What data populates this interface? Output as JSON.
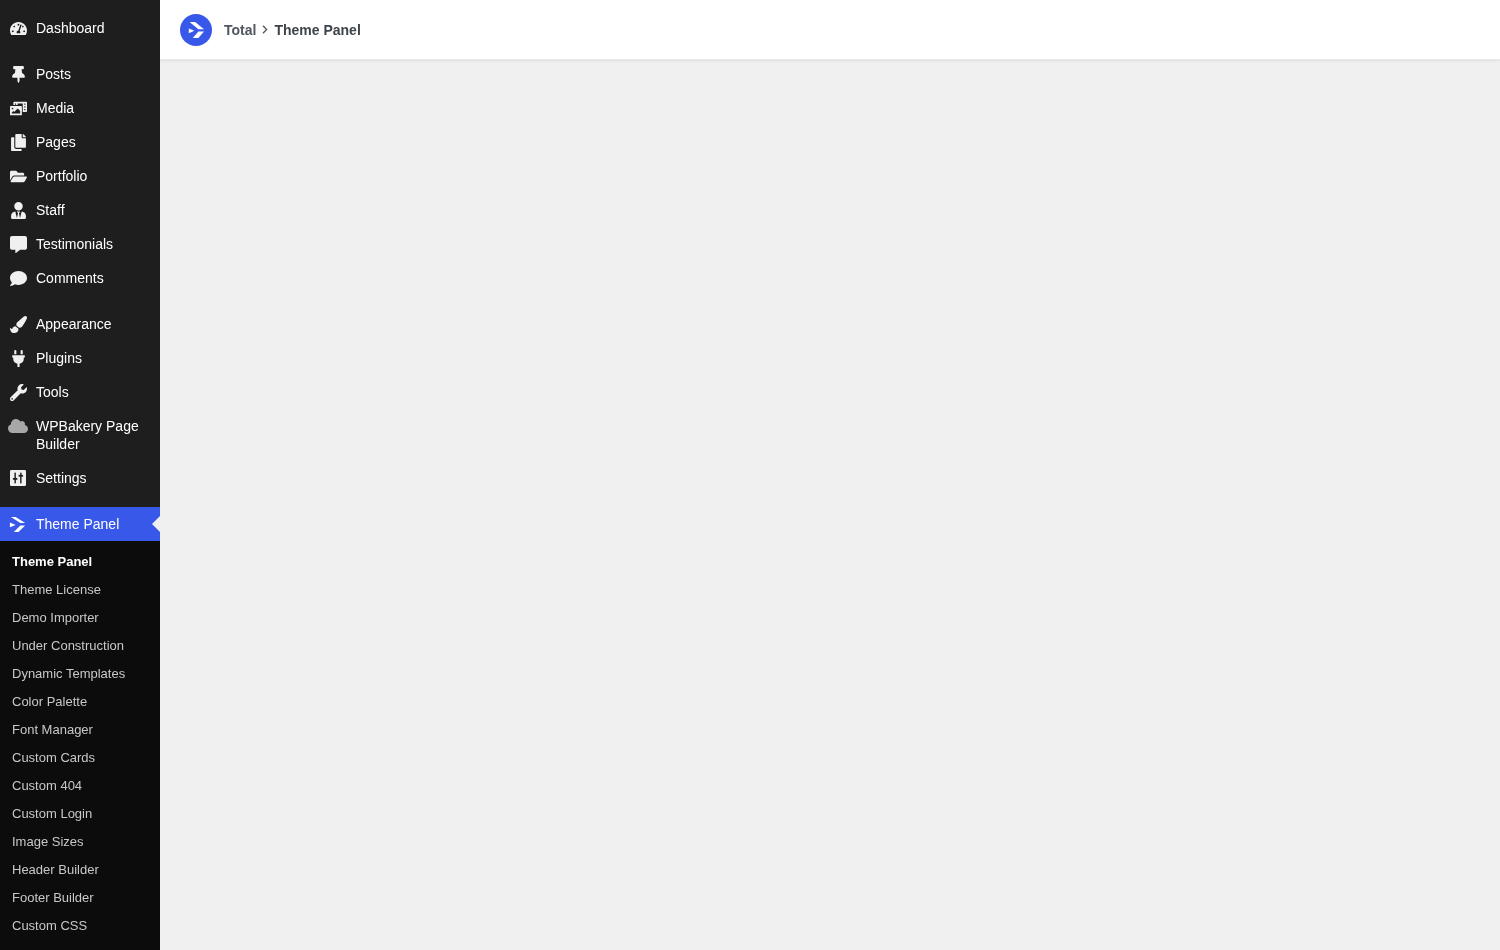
{
  "header": {
    "breadcrumb": [
      "Total",
      "Theme Panel"
    ]
  },
  "sidebar": {
    "menu_groups": [
      {
        "items": [
          {
            "label": "Dashboard",
            "selected": false
          }
        ]
      },
      {
        "items": [
          {
            "label": "Posts",
            "selected": false
          },
          {
            "label": "Media",
            "selected": false
          },
          {
            "label": "Pages",
            "selected": false
          },
          {
            "label": "Portfolio",
            "selected": false
          },
          {
            "label": "Staff",
            "selected": false
          },
          {
            "label": "Testimonials",
            "selected": false
          },
          {
            "label": "Comments",
            "selected": false
          }
        ]
      },
      {
        "items": [
          {
            "label": "Appearance",
            "selected": false
          },
          {
            "label": "Plugins",
            "selected": false
          },
          {
            "label": "Tools",
            "selected": false
          },
          {
            "label": "WPBakery Page Builder",
            "selected": false
          },
          {
            "label": "Settings",
            "selected": false
          }
        ]
      },
      {
        "items": [
          {
            "label": "Theme Panel",
            "selected": true,
            "submenu": [
              {
                "label": "Theme Panel",
                "selected": true
              },
              {
                "label": "Theme License",
                "selected": false
              },
              {
                "label": "Demo Importer",
                "selected": false
              },
              {
                "label": "Under Construction",
                "selected": false
              },
              {
                "label": "Dynamic Templates",
                "selected": false
              },
              {
                "label": "Color Palette",
                "selected": false
              },
              {
                "label": "Font Manager",
                "selected": false
              },
              {
                "label": "Custom Cards",
                "selected": false
              },
              {
                "label": "Custom 404",
                "selected": false
              },
              {
                "label": "Custom Login",
                "selected": false
              },
              {
                "label": "Image Sizes",
                "selected": false
              },
              {
                "label": "Header Builder",
                "selected": false
              },
              {
                "label": "Footer Builder",
                "selected": false
              },
              {
                "label": "Custom CSS",
                "selected": false
              }
            ]
          }
        ]
      }
    ]
  }
}
